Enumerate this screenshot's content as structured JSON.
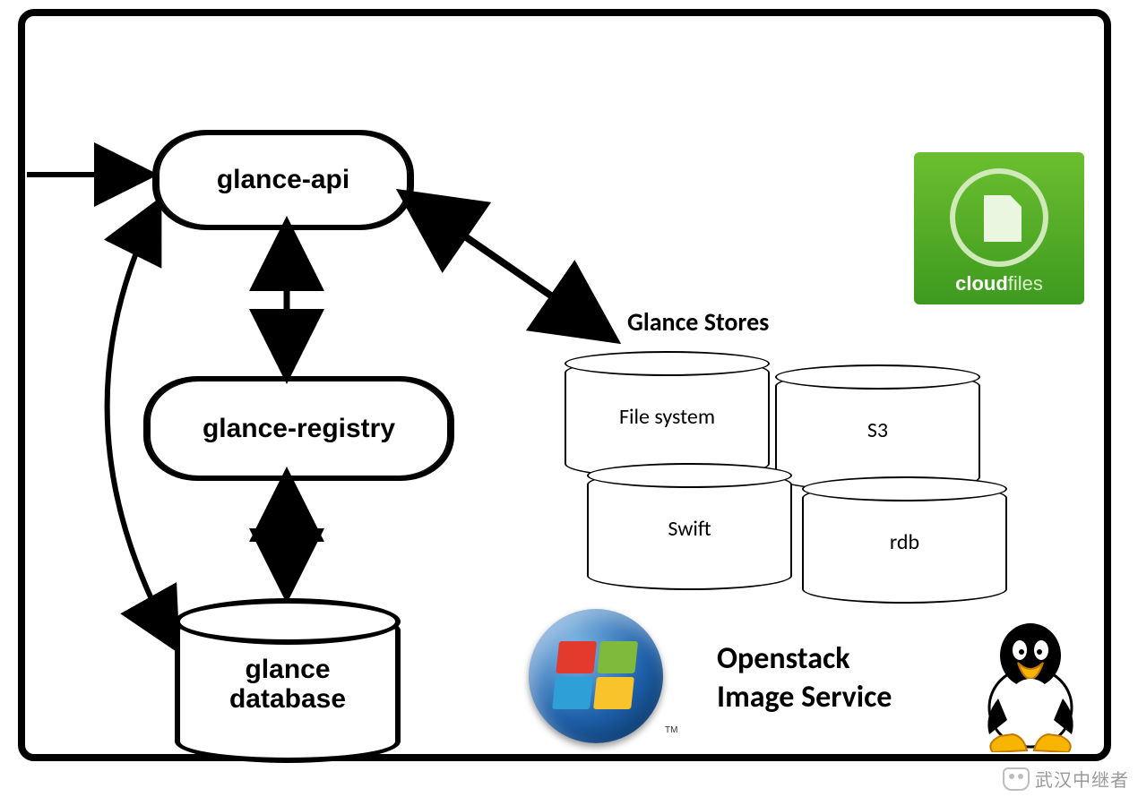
{
  "diagram": {
    "title_line1": "Openstack",
    "title_line2": "Image Service",
    "nodes": {
      "api": "glance-api",
      "registry": "glance-registry",
      "database_line1": "glance",
      "database_line2": "database"
    },
    "stores": {
      "heading": "Glance Stores",
      "items": [
        "File system",
        "S3",
        "Swift",
        "rdb"
      ]
    },
    "logos": {
      "cloudfiles_bold": "cloud",
      "cloudfiles_light": "files",
      "windows_tm": "TM",
      "tux_name": "linux-tux-icon",
      "windows_name": "windows-logo-icon",
      "cloudfiles_name": "cloudfiles-logo"
    },
    "watermark": "武汉中继者",
    "edges": [
      {
        "from": "external",
        "to": "glance-api",
        "dir": "one"
      },
      {
        "from": "glance-api",
        "to": "glance-registry",
        "dir": "both"
      },
      {
        "from": "glance-registry",
        "to": "glance-database",
        "dir": "both"
      },
      {
        "from": "glance-api",
        "to": "glance-database",
        "dir": "both",
        "curvature": "left-arc"
      },
      {
        "from": "glance-api",
        "to": "glance-stores",
        "dir": "both"
      }
    ]
  }
}
